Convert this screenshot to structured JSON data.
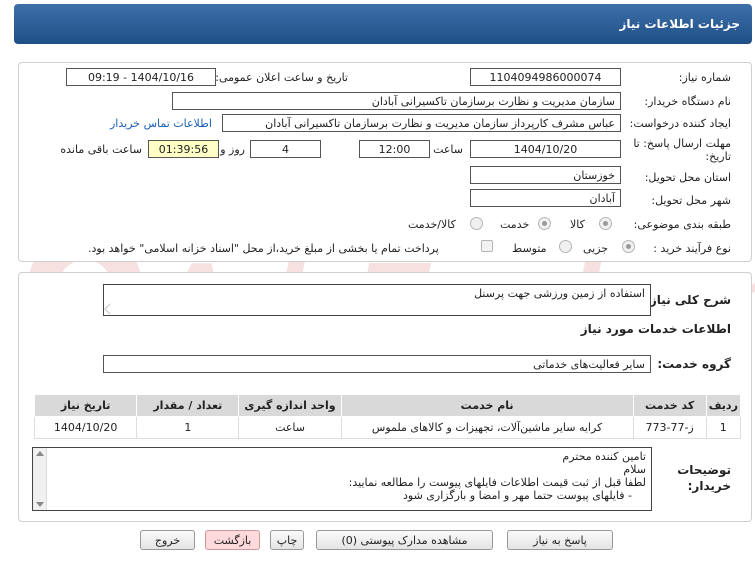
{
  "header": {
    "title": "جزئیات اطلاعات نیاز"
  },
  "form": {
    "need_number_label": "شماره نیاز:",
    "need_number": "1104094986000074",
    "announce_label": "تاریخ و ساعت اعلان عمومی:",
    "announce_value": "1404/10/16 - 09:19",
    "buyer_org_label": "نام دستگاه خریدار:",
    "buyer_org": "سازمان مدیریت و نظارت برسازمان تاکسیرانی آبادان",
    "requester_label": "ایجاد کننده درخواست:",
    "requester": "عباس مشرف کارپرداز سازمان مدیریت و نظارت برسازمان تاکسیرانی آبادان",
    "contact_link": "اطلاعات تماس خریدار",
    "deadline_label": "مهلت ارسال پاسخ: تا تاریخ:",
    "deadline_date": "1404/10/20",
    "time_label": "ساعت",
    "deadline_time": "12:00",
    "days_value": "4",
    "days_label": "روز و",
    "remaining_time": "01:39:56",
    "remaining_label": "ساعت باقی مانده",
    "province_label": "استان محل تحویل:",
    "province": "خوزستان",
    "city_label": "شهر محل تحویل:",
    "city": "آبادان",
    "category_label": "طبقه بندی موضوعی:",
    "category_options": [
      "کالا",
      "خدمت",
      "کالا/خدمت"
    ],
    "purchase_type_label": "نوع فرآیند خرید :",
    "purchase_options": [
      "جزیی",
      "متوسط"
    ],
    "payment_note": "پرداخت تمام یا بخشی از مبلغ خرید،از محل \"اسناد خزانه اسلامی\" خواهد بود."
  },
  "description": {
    "label": "شرح کلی نیاز:",
    "value": "استفاده از زمین ورزشی جهت پرسنل"
  },
  "services": {
    "section_title": "اطلاعات خدمات مورد نیاز",
    "group_label": "گروه خدمت:",
    "group_value": "سایر فعالیت‌های خدماتی",
    "columns": [
      "ردیف",
      "کد خدمت",
      "نام خدمت",
      "واحد اندازه گیری",
      "تعداد / مقدار",
      "تاریخ نیاز"
    ],
    "rows": [
      [
        "1",
        "ز-77-773",
        "کرایه سایر ماشین‌آلات، تجهیزات و کالاهای ملموس",
        "ساعت",
        "1",
        "1404/10/20"
      ]
    ]
  },
  "notes": {
    "label": "توضیحات خریدار:",
    "lines": [
      "تامین کننده محترم",
      "سلام",
      "لطفا قبل از ثبت قیمت اطلاعات فایلهای پیوست را مطالعه نمایید:",
      "    - فایلهای پیوست حتما مهر و امضا و بارگزاری شود"
    ]
  },
  "buttons": {
    "reply": "پاسخ به نیاز",
    "attachments": "مشاهده مدارک پیوستی (0)",
    "print": "چاپ",
    "back": "بازگشت",
    "exit": "خروج"
  },
  "colors": {
    "header_bg": "#2a5d97",
    "remaining_bg": "#ffffc6",
    "link": "#1a5fb4"
  }
}
